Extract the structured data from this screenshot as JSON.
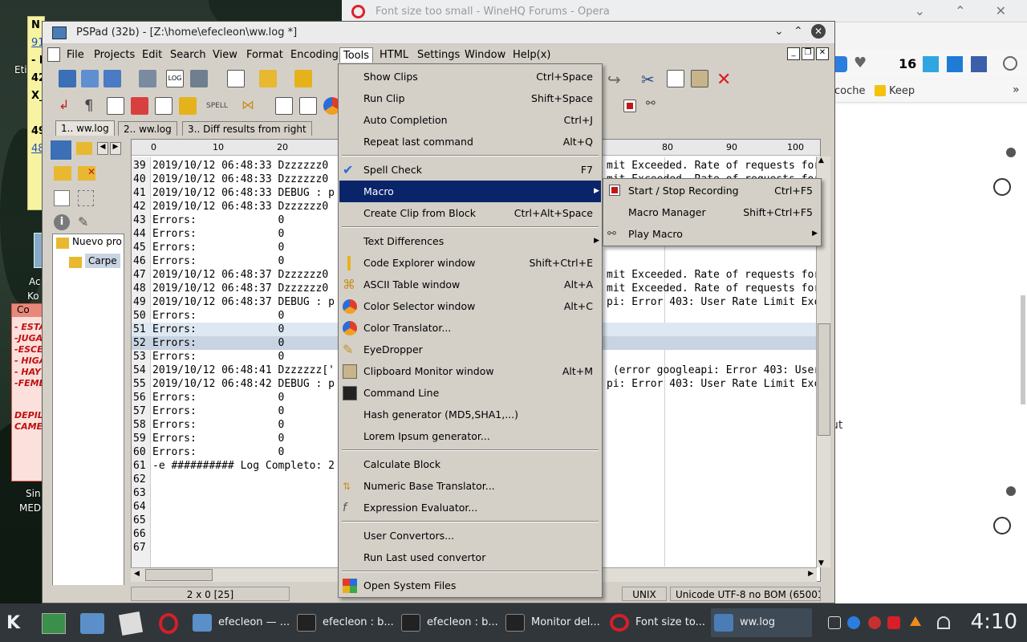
{
  "opera": {
    "tab_title": "Font size too small - WineHQ Forums - Opera",
    "badge_count": "16",
    "bookmark_1": "coche",
    "bookmark_2": "Keep",
    "side_text": "ut"
  },
  "desktop": {
    "sticky_lines": [
      "N",
      "91",
      "- l",
      "42",
      "X_",
      "49",
      "48"
    ],
    "label_etiq": "Eti",
    "label_ac": "Ac",
    "label_ko": "Ko",
    "label_sin": "Sin",
    "label_med": "MED",
    "red_window_title": "Co",
    "red_window_lines": [
      "- ESTA",
      "-JUGA",
      "-ESCE",
      "- HIGA",
      "- HAY",
      "-FEME",
      "",
      "DEPIL",
      "CAME"
    ]
  },
  "pspad": {
    "title": "PSPad (32b) - [Z:\\home\\efecleon\\ww.log *]",
    "menu": [
      "File",
      "Projects",
      "Edit",
      "Search",
      "View",
      "Format",
      "Encoding",
      "Tools",
      "HTML",
      "Settings",
      "Window",
      "Help(x)"
    ],
    "tabs": [
      "1.. ww.log",
      "2.. ww.log",
      "3.. Diff results from right"
    ],
    "tree_items": [
      "Nuevo pro",
      "Carpe"
    ],
    "ruler_labels": [
      "0",
      "10",
      "20",
      "80",
      "90",
      "100"
    ],
    "lines": [
      {
        "num": "39",
        "left": "2019/10/12 06:48:33 Dzzzzzz0",
        "right": "mit Exceeded. Rate of requests for"
      },
      {
        "num": "40",
        "left": "2019/10/12 06:48:33 Dzzzzzz0",
        "right": "mit Exceeded. Rate of requests for"
      },
      {
        "num": "41",
        "left": "2019/10/12 06:48:33 DEBUG : p",
        "right": ""
      },
      {
        "num": "42",
        "left": "2019/10/12 06:48:33 Dzzzzzz0",
        "right": ""
      },
      {
        "num": "43",
        "left": "Errors:             0",
        "right": ""
      },
      {
        "num": "44",
        "left": "Errors:             0",
        "right": ""
      },
      {
        "num": "45",
        "left": "Errors:             0",
        "right": ""
      },
      {
        "num": "46",
        "left": "Errors:             0",
        "right": ""
      },
      {
        "num": "47",
        "left": "2019/10/12 06:48:37 Dzzzzzz0",
        "right": "mit Exceeded. Rate of requests for"
      },
      {
        "num": "48",
        "left": "2019/10/12 06:48:37 Dzzzzzz0",
        "right": "mit Exceeded. Rate of requests for"
      },
      {
        "num": "49",
        "left": "2019/10/12 06:48:37 DEBUG : p",
        "right": "pi: Error 403: User Rate Limit Exc"
      },
      {
        "num": "50",
        "left": "Errors:             0",
        "right": ""
      },
      {
        "num": "51",
        "left": "Errors:             0",
        "right": ""
      },
      {
        "num": "52",
        "left": "Errors:             0",
        "right": ""
      },
      {
        "num": "53",
        "left": "Errors:             0",
        "right": ""
      },
      {
        "num": "54",
        "left": "2019/10/12 06:48:41 Dzzzzzz['",
        "right": " (error googleapi: Error 403: User"
      },
      {
        "num": "55",
        "left": "2019/10/12 06:48:42 DEBUG : p",
        "right": "pi: Error 403: User Rate Limit Exc"
      },
      {
        "num": "56",
        "left": "Errors:             0",
        "right": ""
      },
      {
        "num": "57",
        "left": "Errors:             0",
        "right": ""
      },
      {
        "num": "58",
        "left": "Errors:             0",
        "right": ""
      },
      {
        "num": "59",
        "left": "Errors:             0",
        "right": ""
      },
      {
        "num": "60",
        "left": "Errors:             0",
        "right": ""
      },
      {
        "num": "61",
        "left": "-e ########## Log Completo: 2",
        "right": ""
      },
      {
        "num": "62",
        "left": "",
        "right": ""
      },
      {
        "num": "63",
        "left": "",
        "right": ""
      },
      {
        "num": "64",
        "left": "",
        "right": ""
      },
      {
        "num": "65",
        "left": "",
        "right": ""
      },
      {
        "num": "66",
        "left": "",
        "right": ""
      },
      {
        "num": "67",
        "left": "",
        "right": ""
      }
    ],
    "status": {
      "position": "2 x 0  [25]",
      "eol": "UNIX",
      "encoding": "Unicode UTF-8 no BOM (65001"
    }
  },
  "tools_menu": {
    "items": [
      {
        "label": "Show Clips",
        "shortcut": "Ctrl+Space",
        "icon": "none"
      },
      {
        "label": "Run Clip",
        "shortcut": "Shift+Space",
        "icon": "none"
      },
      {
        "label": "Auto Completion",
        "shortcut": "Ctrl+J",
        "icon": "none"
      },
      {
        "label": "Repeat last command",
        "shortcut": "Alt+Q",
        "icon": "none"
      },
      {
        "label": "Spell Check",
        "shortcut": "F7",
        "icon": "spellcheck-icon"
      },
      {
        "label": "Macro",
        "shortcut": "",
        "icon": "none"
      },
      {
        "label": "Create Clip from Block",
        "shortcut": "Ctrl+Alt+Space",
        "icon": "none"
      },
      {
        "label": "Text Differences",
        "shortcut": "",
        "icon": "none"
      },
      {
        "label": "Code Explorer window",
        "shortcut": "Shift+Ctrl+E",
        "icon": "code-explorer-icon"
      },
      {
        "label": "ASCII Table window",
        "shortcut": "Alt+A",
        "icon": "ascii-table-icon"
      },
      {
        "label": "Color Selector window",
        "shortcut": "Alt+C",
        "icon": "color-selector-icon"
      },
      {
        "label": "Color Translator...",
        "shortcut": "",
        "icon": "color-translator-icon"
      },
      {
        "label": "EyeDropper",
        "shortcut": "",
        "icon": "eyedropper-icon"
      },
      {
        "label": "Clipboard  Monitor window",
        "shortcut": "Alt+M",
        "icon": "clipboard-icon"
      },
      {
        "label": "Command Line",
        "shortcut": "",
        "icon": "command-line-icon"
      },
      {
        "label": "Hash generator (MD5,SHA1,...)",
        "shortcut": "",
        "icon": "none"
      },
      {
        "label": "Lorem Ipsum generator...",
        "shortcut": "",
        "icon": "none"
      },
      {
        "label": "Calculate Block",
        "shortcut": "",
        "icon": "none"
      },
      {
        "label": "Numeric Base Translator...",
        "shortcut": "",
        "icon": "numeric-base-icon"
      },
      {
        "label": "Expression Evaluator...",
        "shortcut": "",
        "icon": "function-icon"
      },
      {
        "label": "User Convertors...",
        "shortcut": "",
        "icon": "none"
      },
      {
        "label": "Run Last used convertor",
        "shortcut": "",
        "icon": "none"
      },
      {
        "label": "Open System Files",
        "shortcut": "",
        "icon": "system-files-icon"
      }
    ]
  },
  "macro_menu": {
    "items": [
      {
        "label": "Start / Stop Recording",
        "shortcut": "Ctrl+F5"
      },
      {
        "label": "Macro Manager",
        "shortcut": "Shift+Ctrl+F5"
      },
      {
        "label": "Play Macro",
        "shortcut": ""
      }
    ]
  },
  "taskbar": {
    "tasks": [
      "efecleon — ...",
      "efecleon : b...",
      "efecleon : b...",
      "Monitor del...",
      "Font size to...",
      "ww.log"
    ],
    "clock": "4:10"
  },
  "colors": {
    "menu_highlight": "#0a246a",
    "taskbar": "#31363b",
    "pspad_face": "#d4d0c8"
  }
}
